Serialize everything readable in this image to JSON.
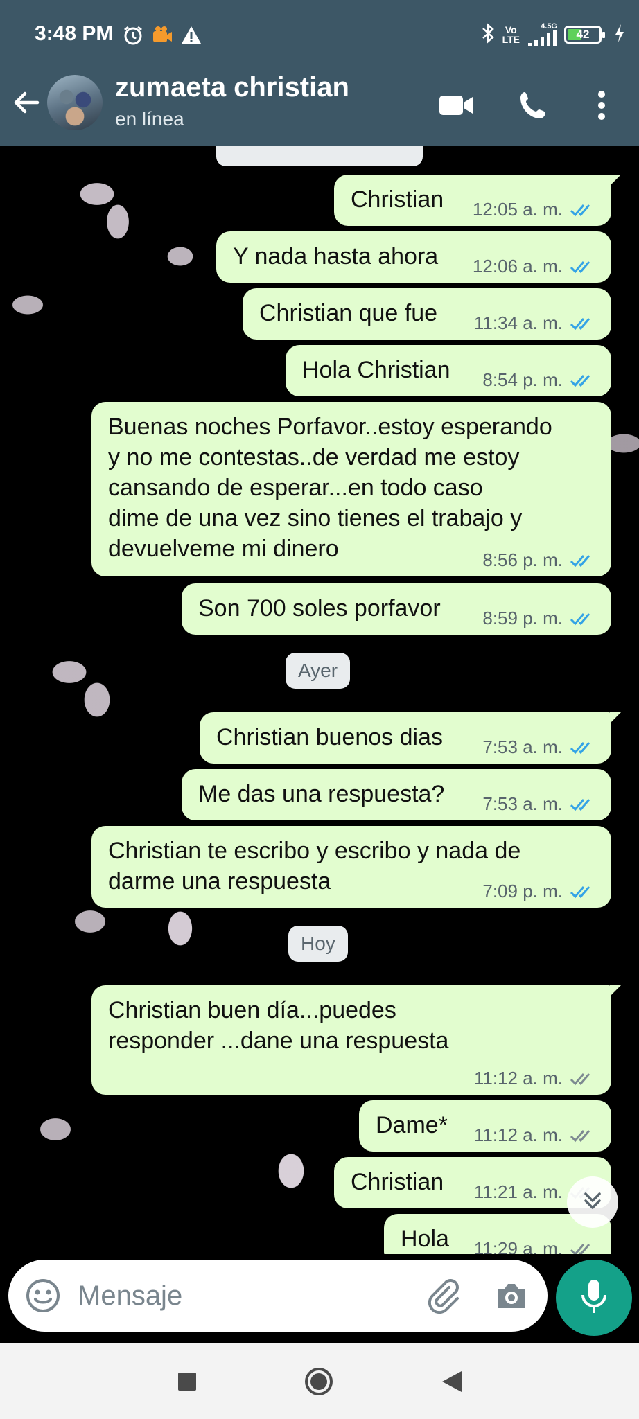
{
  "status_bar": {
    "time": "3:48 PM",
    "network_top": "Vo",
    "network_bottom": "LTE",
    "signal_label": "4.5G",
    "battery": "42",
    "battery_level": 0.42,
    "icons": [
      "alarm-icon",
      "video-app-icon",
      "warning-icon",
      "bluetooth-icon",
      "signal-icon",
      "charging-icon"
    ]
  },
  "header": {
    "contact_name": "zumaeta christian",
    "contact_status": "en línea",
    "icons": [
      "back-arrow-icon",
      "video-call-icon",
      "phone-icon",
      "more-options-icon"
    ],
    "color": "#3d5766"
  },
  "messages": [
    {
      "text": "Christian",
      "time": "12:05 a. m.",
      "status": "read"
    },
    {
      "text": "Y nada hasta ahora",
      "time": "12:06 a. m.",
      "status": "read"
    },
    {
      "text": "Christian que fue",
      "time": "11:34 a. m.",
      "status": "read"
    },
    {
      "text": "Hola Christian",
      "time": "8:54 p. m.",
      "status": "read"
    },
    {
      "text": "Buenas noches Porfavor..estoy esperando\ny no me contestas..de verdad me estoy\ncansando de esperar...en todo caso\ndime de una vez sino tienes el trabajo y\ndevuelveme mi dinero",
      "time": "8:56 p. m.",
      "status": "read"
    },
    {
      "text": "Son 700 soles porfavor",
      "time": "8:59 p. m.",
      "status": "read"
    },
    {
      "text": "Christian buenos dias",
      "time": "7:53 a. m.",
      "status": "read"
    },
    {
      "text": "Me das una respuesta?",
      "time": "7:53 a. m.",
      "status": "read"
    },
    {
      "text": "Christian te escribo y escribo y nada de\ndarme una respuesta",
      "time": "7:09 p. m.",
      "status": "read"
    },
    {
      "text": "Christian buen día...puedes\nresponder ...dane una respuesta",
      "time": "11:12 a. m.",
      "status": "delivered"
    },
    {
      "text": "Dame*",
      "time": "11:12 a. m.",
      "status": "delivered"
    },
    {
      "text": "Christian",
      "time": "11:21 a. m.",
      "status": "delivered"
    },
    {
      "text": "Hola",
      "time": "11:29 a. m.",
      "status": "delivered"
    }
  ],
  "day_labels": {
    "yesterday": "Ayer",
    "today": "Hoy"
  },
  "input": {
    "placeholder": "Mensaje",
    "value": ""
  },
  "colors": {
    "bubble_out": "#e2fdcf",
    "read_tick": "#34a3e6",
    "delivered_tick": "#7d8a91",
    "accent": "#14a189"
  },
  "nav_bar": {
    "icons": [
      "recents-square-icon",
      "home-circle-icon",
      "back-triangle-icon"
    ]
  }
}
